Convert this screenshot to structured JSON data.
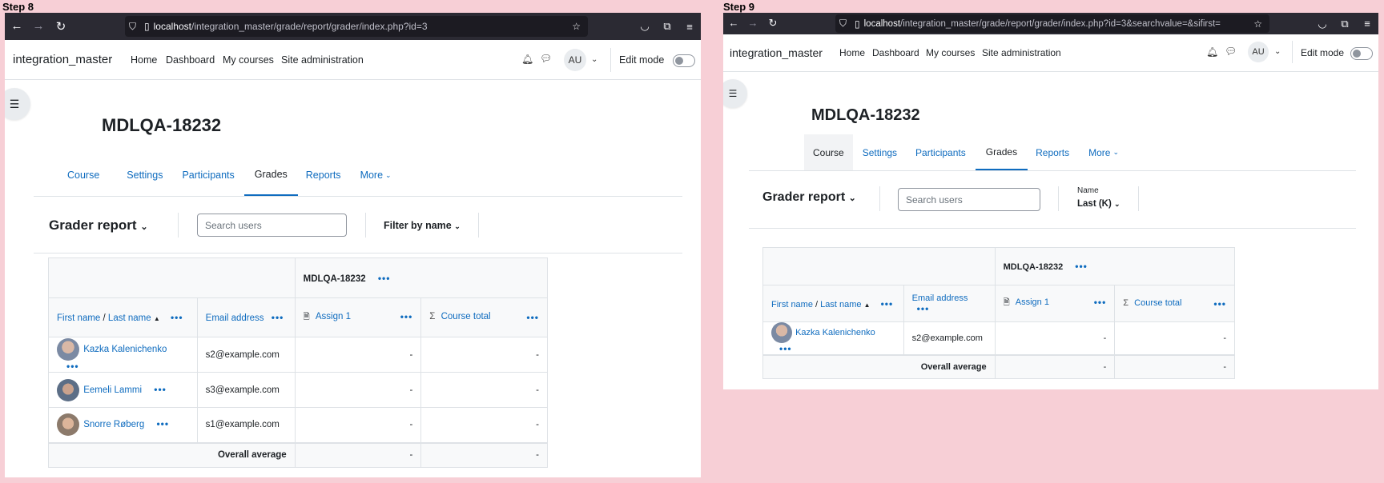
{
  "left": {
    "step_label": "Step 8",
    "url_host": "localhost",
    "url_path": "/integration_master/grade/report/grader/index.php?id=3",
    "site_name": "integration_master",
    "nav": [
      "Home",
      "Dashboard",
      "My courses",
      "Site administration"
    ],
    "avatar_initials": "AU",
    "edit_mode": "Edit mode",
    "course_title": "MDLQA-18232",
    "tabs": [
      "Course",
      "Settings",
      "Participants",
      "Grades",
      "Reports",
      "More"
    ],
    "report_title": "Grader report",
    "search_placeholder": "Search users",
    "filter_label": "Filter by name",
    "table": {
      "course_header": "MDLQA-18232",
      "col_first": "First name",
      "col_slash": " / ",
      "col_last": "Last name",
      "col_email": "Email address",
      "col_assign": "Assign 1",
      "col_total": "Course total",
      "rows": [
        {
          "name": "Kazka Kalenichenko",
          "email": "s2@example.com",
          "assign": "-",
          "total": "-"
        },
        {
          "name": "Eemeli Lammi",
          "email": "s3@example.com",
          "assign": "-",
          "total": "-"
        },
        {
          "name": "Snorre Røberg",
          "email": "s1@example.com",
          "assign": "-",
          "total": "-"
        }
      ],
      "overall_label": "Overall average",
      "overall_assign": "-",
      "overall_total": "-"
    }
  },
  "right": {
    "step_label": "Step 9",
    "url_host": "localhost",
    "url_path": "/integration_master/grade/report/grader/index.php?id=3&searchvalue=&sifirst=",
    "site_name": "integration_master",
    "nav": [
      "Home",
      "Dashboard",
      "My courses",
      "Site administration"
    ],
    "avatar_initials": "AU",
    "edit_mode": "Edit mode",
    "course_title": "MDLQA-18232",
    "tabs": [
      "Course",
      "Settings",
      "Participants",
      "Grades",
      "Reports",
      "More"
    ],
    "report_title": "Grader report",
    "search_placeholder": "Search users",
    "name_label": "Name",
    "name_value": "Last (K)",
    "table": {
      "course_header": "MDLQA-18232",
      "col_first": "First name",
      "col_slash": " / ",
      "col_last": "Last name",
      "col_email": "Email address",
      "col_assign": "Assign 1",
      "col_total": "Course total",
      "rows": [
        {
          "name": "Kazka Kalenichenko",
          "email": "s2@example.com",
          "assign": "-",
          "total": "-"
        }
      ],
      "overall_label": "Overall average",
      "overall_assign": "-",
      "overall_total": "-"
    }
  },
  "icons": {
    "back": "arrow-left-icon",
    "forward": "arrow-right-icon",
    "reload": "reload-icon",
    "shield": "shield-icon",
    "page": "page-icon",
    "star": "star-icon",
    "pocket": "pocket-icon",
    "extensions": "extensions-icon",
    "menu": "hamburger-icon",
    "bell": "bell-icon",
    "chat": "chat-icon",
    "drawer": "list-icon",
    "assign": "assignment-icon",
    "sigma": "sigma-icon",
    "sort": "sort-asc-icon"
  },
  "colors": {
    "background": "#f7cfd6",
    "link": "#0f6cbf",
    "browser_bar": "#2b2a33"
  }
}
